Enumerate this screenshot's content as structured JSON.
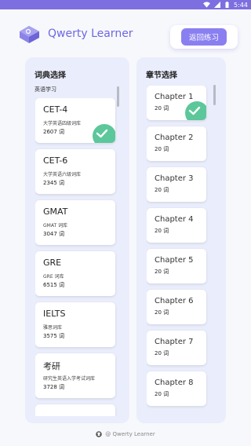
{
  "status_bar": {
    "time": "5:44",
    "icons": [
      "wifi-icon",
      "signal-icon",
      "battery-icon"
    ]
  },
  "header": {
    "app_title": "Qwerty Learner",
    "back_button": "返回练习",
    "logo_icon": "keyboard-key-logo-icon"
  },
  "dictionary_panel": {
    "title": "词典选择",
    "category": "英语学习",
    "items": [
      {
        "name": "CET-4",
        "desc": "大学英语四级词库",
        "count": "2607 词",
        "selected": true
      },
      {
        "name": "CET-6",
        "desc": "大学英语六级词库",
        "count": "2345 词",
        "selected": false
      },
      {
        "name": "GMAT",
        "desc": "GMAT 词库",
        "count": "3047 词",
        "selected": false
      },
      {
        "name": "GRE",
        "desc": "GRE 词库",
        "count": "6515 词",
        "selected": false
      },
      {
        "name": "IELTS",
        "desc": "雅思词库",
        "count": "3575 词",
        "selected": false
      },
      {
        "name": "考研",
        "desc": "研究生英语入学考试词库",
        "count": "3728 词",
        "selected": false
      }
    ]
  },
  "chapter_panel": {
    "title": "章节选择",
    "items": [
      {
        "name": "Chapter 1",
        "count": "20 词",
        "selected": true
      },
      {
        "name": "Chapter 2",
        "count": "20 词",
        "selected": false
      },
      {
        "name": "Chapter 3",
        "count": "20 词",
        "selected": false
      },
      {
        "name": "Chapter 4",
        "count": "20 词",
        "selected": false
      },
      {
        "name": "Chapter 5",
        "count": "20 词",
        "selected": false
      },
      {
        "name": "Chapter 6",
        "count": "20 词",
        "selected": false
      },
      {
        "name": "Chapter 7",
        "count": "20 词",
        "selected": false
      },
      {
        "name": "Chapter 8",
        "count": "20 词",
        "selected": false
      }
    ]
  },
  "footer": {
    "text": "@ Qwerty Learner",
    "icon": "github-icon"
  },
  "colors": {
    "accent": "#6f67e0",
    "button": "#8a7ff0",
    "status_bar": "#7d6fe0",
    "panel": "#eaedfb",
    "selected_badge": "#5cc79a"
  }
}
